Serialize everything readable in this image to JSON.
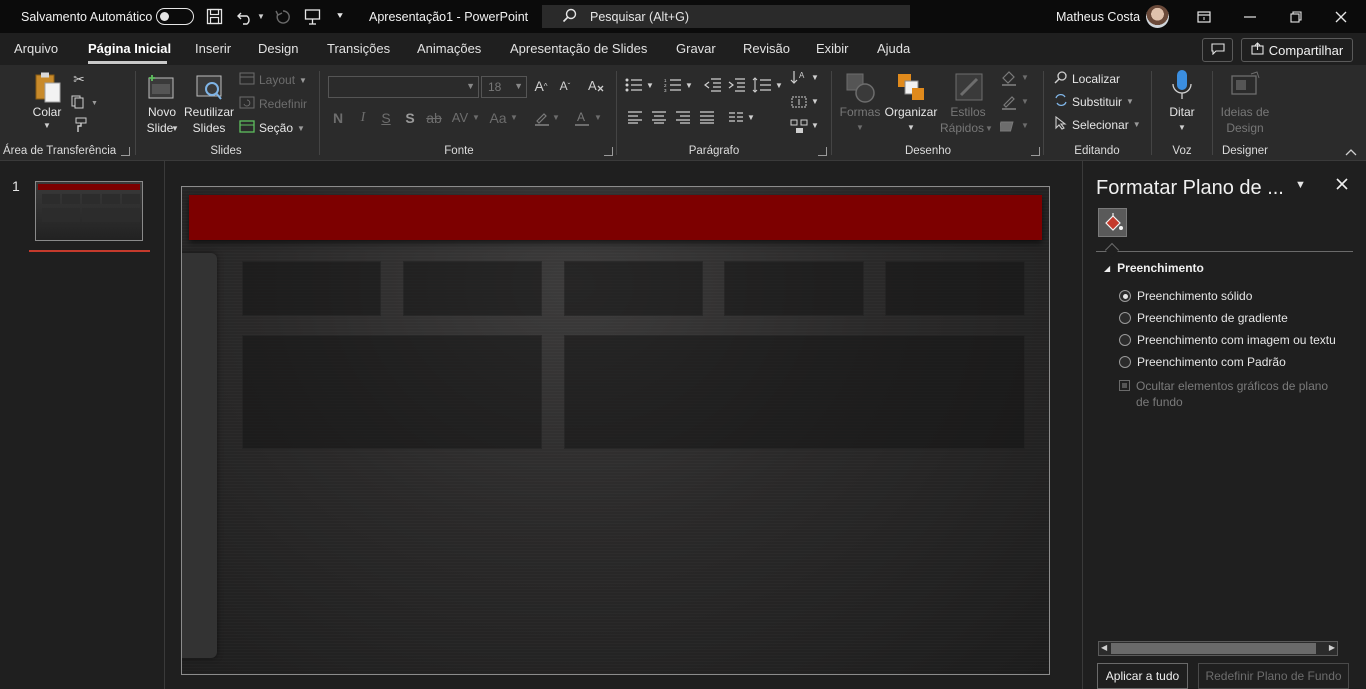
{
  "titlebar": {
    "autosave_label": "Salvamento Automático",
    "document_title": "Apresentação1  -  PowerPoint",
    "search_placeholder": "Pesquisar (Alt+G)",
    "user_name": "Matheus Costa"
  },
  "tabs": [
    "Arquivo",
    "Página Inicial",
    "Inserir",
    "Design",
    "Transições",
    "Animações",
    "Apresentação de Slides",
    "Gravar",
    "Revisão",
    "Exibir",
    "Ajuda"
  ],
  "share_label": "Compartilhar",
  "ribbon": {
    "clipboard": {
      "paste": "Colar",
      "group": "Área de Transferência"
    },
    "slides": {
      "new_slide_1": "Novo",
      "new_slide_2": "Slide",
      "reuse_1": "Reutilizar",
      "reuse_2": "Slides",
      "layout": "Layout",
      "reset": "Redefinir",
      "section": "Seção",
      "group": "Slides"
    },
    "font": {
      "font_size": "18",
      "bold": "N",
      "italic": "I",
      "underline": "S",
      "shadow": "S",
      "strike": "ab",
      "spacing": "AV",
      "case": "Aa",
      "group": "Fonte"
    },
    "paragraph": {
      "group": "Parágrafo"
    },
    "drawing": {
      "shapes": "Formas",
      "arrange": "Organizar",
      "styles_1": "Estilos",
      "styles_2": "Rápidos",
      "group": "Desenho"
    },
    "editing": {
      "find": "Localizar",
      "replace": "Substituir",
      "select": "Selecionar",
      "group": "Editando"
    },
    "voice": {
      "dictate": "Ditar",
      "group": "Voz"
    },
    "designer": {
      "ideas_1": "Ideias de",
      "ideas_2": "Design",
      "group": "Designer"
    }
  },
  "thumbnails": {
    "slide_number": "1"
  },
  "format_pane": {
    "title": "Formatar Plano de ...",
    "section": "Preenchimento",
    "options": [
      {
        "label": "Preenchimento sólido",
        "selected": true
      },
      {
        "label": "Preenchimento de gradiente",
        "selected": false
      },
      {
        "label": "Preenchimento com imagem ou textu",
        "selected": false
      },
      {
        "label": "Preenchimento com Padrão",
        "selected": false
      }
    ],
    "hide_graphics": "Ocultar elementos gráficos de plano de fundo",
    "apply_all": "Aplicar a tudo",
    "reset_bg": "Redefinir Plano de Fundo"
  },
  "colors": {
    "accent_red": "#7d0000",
    "titlebar_bg": "#0b0b0b",
    "ribbon_bg": "#2b2b2b",
    "app_bg": "#1f1f1f"
  }
}
